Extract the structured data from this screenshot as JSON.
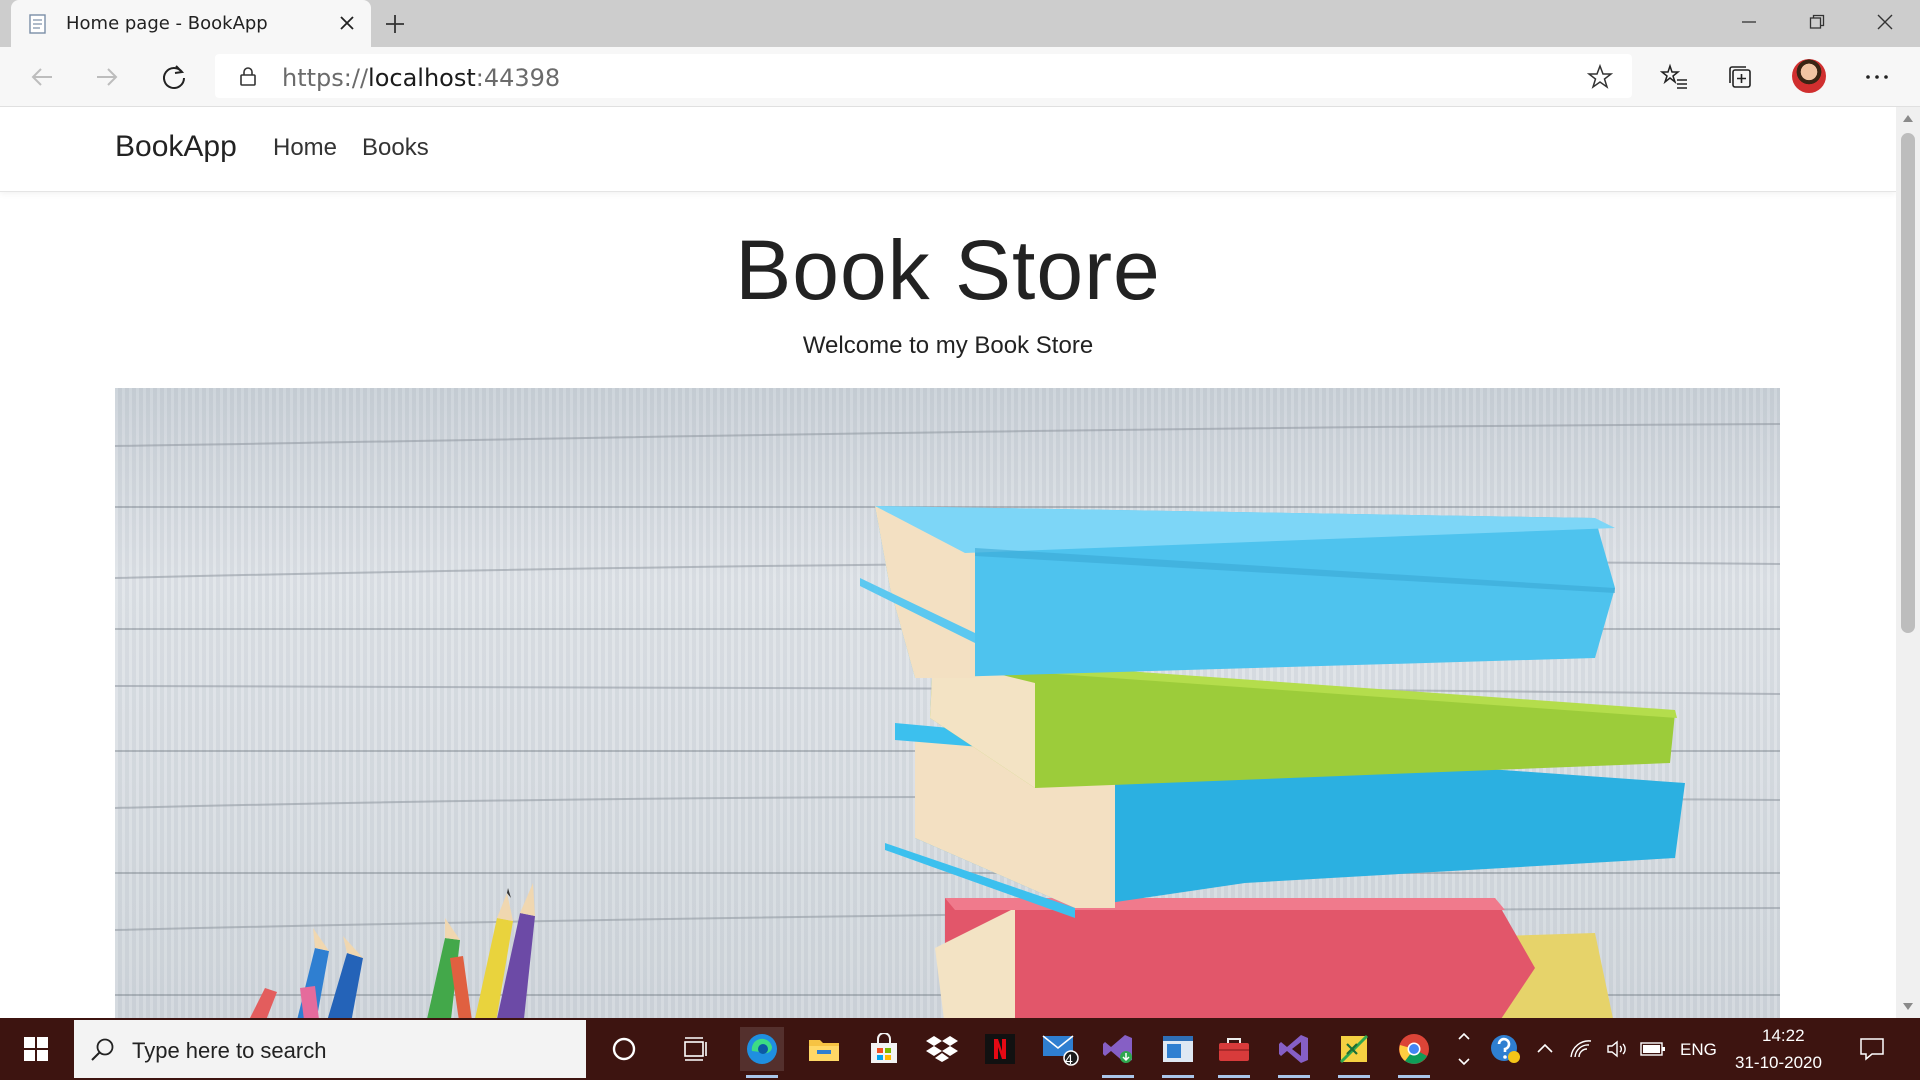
{
  "browser": {
    "tab_title": "Home page - BookApp",
    "url_prefix": "https://",
    "url_host": "localhost",
    "url_port": ":44398"
  },
  "site": {
    "brand": "BookApp",
    "nav": [
      "Home",
      "Books"
    ],
    "hero_title": "Book Store",
    "hero_subtitle": "Welcome to my Book Store"
  },
  "taskbar": {
    "search_placeholder": "Type here to search",
    "mail_badge": "4",
    "language": "ENG",
    "time": "14:22",
    "date": "31-10-2020"
  },
  "colors": {
    "taskbar_bg": "#3d1410",
    "tabstrip_bg": "#cdcdcd",
    "book_blue": "#4ec3ee",
    "book_green": "#9ccc3a",
    "book_red": "#e2566a",
    "book_yellow": "#e6d36a"
  },
  "icons": [
    "page-favicon-icon",
    "close-icon",
    "plus-icon",
    "minimize-icon",
    "restore-icon",
    "back-arrow-icon",
    "forward-arrow-icon",
    "refresh-icon",
    "lock-icon",
    "favorite-star-icon",
    "favorites-icon",
    "collections-icon",
    "profile-avatar",
    "more-icon",
    "windows-start-icon",
    "search-icon",
    "cortana-icon",
    "task-view-icon",
    "edge-icon",
    "file-explorer-icon",
    "store-icon",
    "dropbox-icon",
    "netflix-icon",
    "mail-icon",
    "visual-studio-installer-icon",
    "app-icon",
    "toolbox-icon",
    "visual-studio-icon",
    "excel-like-icon",
    "chrome-icon",
    "help-icon",
    "chevron-up-icon",
    "network-icon",
    "volume-icon",
    "battery-icon",
    "notification-icon"
  ]
}
